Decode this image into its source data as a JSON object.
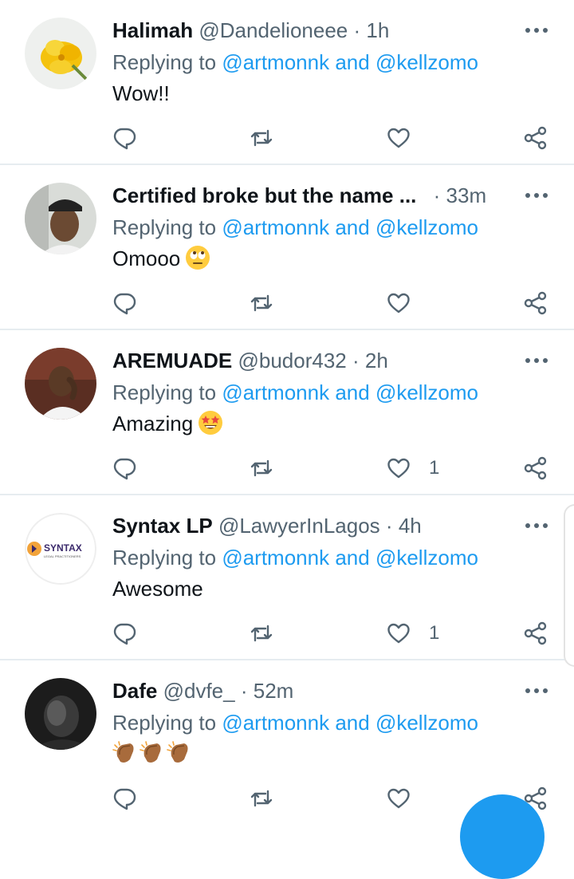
{
  "reply_prefix": "Replying to",
  "reply_joiner": "and",
  "tweets": [
    {
      "name": "Halimah",
      "handle": "@Dandelioneee",
      "time": "1h",
      "mentions": [
        "@artmonnk",
        "@kellzomo"
      ],
      "text": "Wow!!",
      "emoji": "",
      "likes": "",
      "avatar": "flower"
    },
    {
      "name": "Certified broke but the name ...",
      "handle": "",
      "time": "33m",
      "mentions": [
        "@artmonnk",
        "@kellzomo"
      ],
      "text": "Omooo",
      "emoji": "eye-roll-emoji",
      "likes": "",
      "avatar": "person-cap"
    },
    {
      "name": "AREMUADE",
      "handle": "@budor432",
      "time": "2h",
      "mentions": [
        "@artmonnk",
        "@kellzomo"
      ],
      "text": "Amazing",
      "emoji": "star-struck-emoji",
      "likes": "1",
      "avatar": "person-white-shirt"
    },
    {
      "name": "Syntax LP",
      "handle": "@LawyerInLagos",
      "time": "4h",
      "mentions": [
        "@artmonnk",
        "@kellzomo"
      ],
      "text": "Awesome",
      "emoji": "",
      "likes": "1",
      "avatar": "syntax-logo",
      "logo_text": "SYNTAX",
      "logo_subtext": "LEGAL PRACTITIONERS"
    },
    {
      "name": "Dafe",
      "handle": "@dvfe_",
      "time": "52m",
      "mentions": [
        "@artmonnk",
        "@kellzomo"
      ],
      "text": "",
      "emoji": "clapping-hands-emoji x3",
      "likes": "",
      "avatar": "person-dark"
    }
  ],
  "colors": {
    "link": "#1d9bf0",
    "secondary_text": "#536471",
    "icon": "#536471",
    "divider": "#e6ecf0",
    "fab": "#1d9bf0"
  },
  "icons": [
    "more-icon",
    "reply-icon",
    "retweet-icon",
    "like-icon",
    "share-icon",
    "compose-fab"
  ]
}
